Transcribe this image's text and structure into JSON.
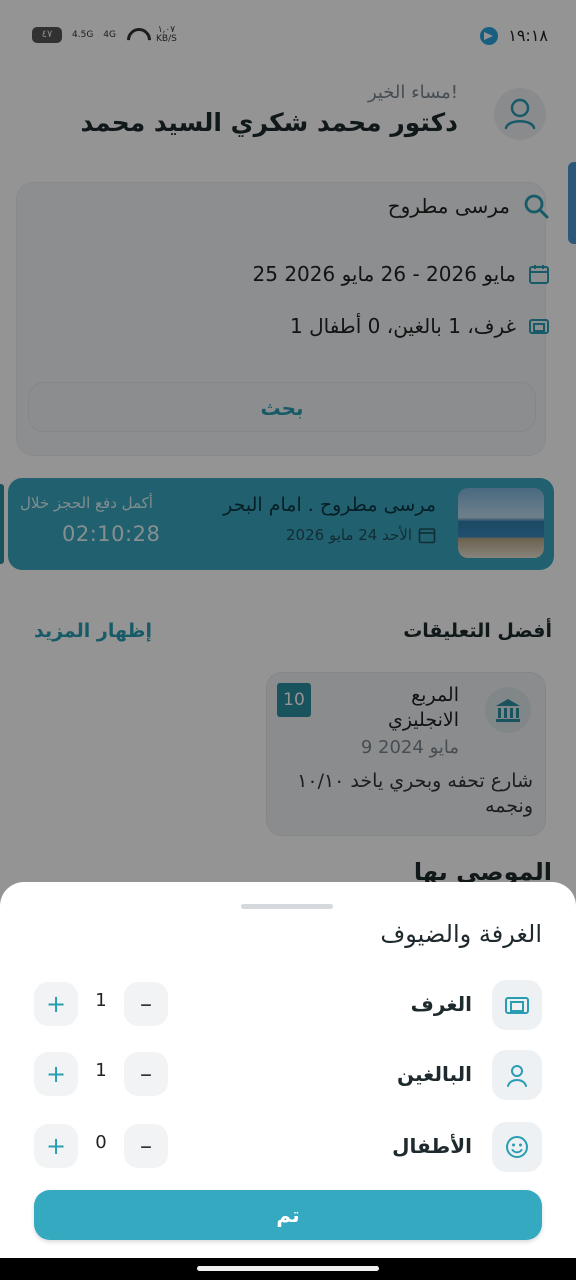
{
  "status_bar": {
    "time": "١٩:١٨",
    "battery": "٤٧",
    "net_speed_value": "١,٠٧",
    "net_speed_unit": "KB/S",
    "signal_1": "4.5G",
    "signal_2": "4G"
  },
  "header": {
    "greeting": "مساء الخير!",
    "user_name": "دكتور محمد شكري السيد محمد"
  },
  "search": {
    "destination": "مرسى مطروح",
    "dates": "25 مايو 2026 - 26 مايو 2026",
    "guests": "1 غرف، 1 بالغين، 0 أطفال",
    "button_label": "بحث"
  },
  "booking": {
    "title": "مرسى مطروح . امام البحر",
    "date": "الأحد 24 مايو 2026",
    "pay_message": "أكمل دفع الحجز خلال",
    "timer": "02:10:28"
  },
  "reviews": {
    "section_title": "أفضل التعليقات",
    "show_more_label": "إظهار المزيد",
    "items": [
      {
        "place": "المربع الانجليزي",
        "score": "10",
        "date": "9 مايو 2024",
        "text": "شارع تحفه وبحري ياخد ١٠/١٠ ونجمه"
      }
    ]
  },
  "recommended_title": "الموصى بها",
  "sheet": {
    "title": "الغرفة والضيوف",
    "rows": [
      {
        "label": "الغرف",
        "value": "1",
        "icon": "room-icon"
      },
      {
        "label": "البالغين",
        "value": "1",
        "icon": "adult-icon"
      },
      {
        "label": "الأطفال",
        "value": "0",
        "icon": "child-icon"
      }
    ],
    "minus_symbol": "–",
    "plus_symbol": "+",
    "done_label": "تم"
  },
  "colors": {
    "accent": "#35a9c0",
    "banner": "#39a6bd",
    "score_badge": "#2a8fa3"
  }
}
